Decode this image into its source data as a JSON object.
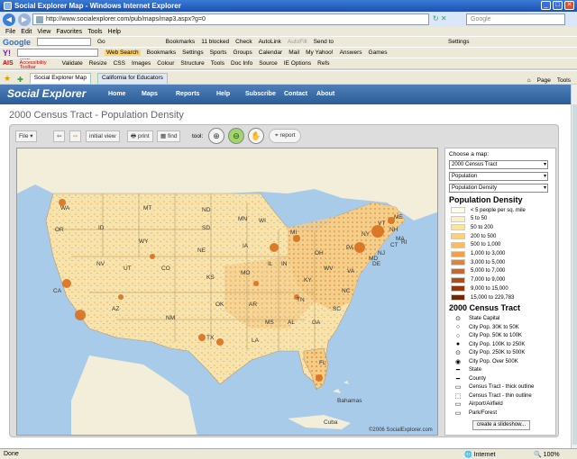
{
  "window": {
    "title": "Social Explorer Map - Windows Internet Explorer"
  },
  "browser": {
    "address": "http://www.socialexplorer.com/pub/maps/map3.aspx?g=0",
    "search_placeholder": "Google",
    "menu": [
      "File",
      "Edit",
      "View",
      "Favorites",
      "Tools",
      "Help"
    ],
    "google_toolbar": [
      "Go",
      "Bookmarks",
      "11 blocked",
      "Check",
      "AutoLink",
      "AutoFill",
      "Send to",
      "Settings"
    ],
    "yahoo_toolbar": [
      "Web Search",
      "Bookmarks",
      "Settings",
      "Sports",
      "Groups",
      "Calendar",
      "Mail",
      "My Yahoo!",
      "Answers",
      "Games"
    ],
    "ais_toolbar": [
      "Web Accessibility Toolbar",
      "Validate",
      "Resize",
      "CSS",
      "Images",
      "Colour",
      "Structure",
      "Tools",
      "Doc Info",
      "Source",
      "IE Options",
      "Refs"
    ],
    "tabs": [
      "Social Explorer Map",
      "California for Educators"
    ],
    "command_bar": [
      "Page",
      "Tools"
    ],
    "status": {
      "left": "Done",
      "zone": "Internet",
      "zoom": "100%"
    }
  },
  "site": {
    "logo": "Social Explorer",
    "nav": [
      "Home",
      "Maps",
      "Reports",
      "Help",
      "Subscribe",
      "Contact",
      "About"
    ],
    "page_title": "2000 Census Tract - Population Density"
  },
  "map_toolbar": {
    "file": "File",
    "initial_view": "initial view",
    "print": "print",
    "find": "find",
    "tool_label": "tool:",
    "report": "report"
  },
  "map": {
    "credit": "©2006 SocialExplorer.com",
    "labels": [
      "WA",
      "MT",
      "ND",
      "MN",
      "OR",
      "ID",
      "SD",
      "WI",
      "ME",
      "WY",
      "MI",
      "NV",
      "NE",
      "IA",
      "NY",
      "VT",
      "NH",
      "UT",
      "CO",
      "IL",
      "IN",
      "OH",
      "PA",
      "MA",
      "CT",
      "RI",
      "CA",
      "KS",
      "MO",
      "WV",
      "VA",
      "NJ",
      "DE",
      "MD",
      "KY",
      "NC",
      "AZ",
      "NM",
      "OK",
      "AR",
      "TN",
      "SC",
      "MS",
      "AL",
      "GA",
      "TX",
      "LA",
      "FL",
      "Bahamas",
      "Cuba"
    ],
    "colors": {
      "water": "#a8cbea",
      "land": "#f7e3ad",
      "dense": "#d9701f"
    }
  },
  "side": {
    "choose": "Choose a map:",
    "select1": "2000 Census Tract",
    "select2": "Population",
    "select3": "Population Density",
    "legend_title": "Population Density",
    "legend": [
      {
        "label": "< 5 people per sq. mile",
        "color": "#fffae0"
      },
      {
        "label": "5 to 50",
        "color": "#fdf0c0"
      },
      {
        "label": "50 to 200",
        "color": "#fbe3a0"
      },
      {
        "label": "200 to 500",
        "color": "#f8d080"
      },
      {
        "label": "500 to 1,000",
        "color": "#f5bb66"
      },
      {
        "label": "1,000 to 3,000",
        "color": "#f0a04c"
      },
      {
        "label": "3,000 to 5,000",
        "color": "#e18234"
      },
      {
        "label": "5,000 to 7,000",
        "color": "#cc6622"
      },
      {
        "label": "7,000 to 9,000",
        "color": "#b04e14"
      },
      {
        "label": "9,000 to 15,000",
        "color": "#8e3a0c"
      },
      {
        "label": "15,000 to 229,783",
        "color": "#6a2806"
      }
    ],
    "ct_title": "2000 Census Tract",
    "ct_items": [
      {
        "sym": "⊙",
        "label": "State Capital"
      },
      {
        "sym": "○",
        "label": "City Pop. 30K to 50K"
      },
      {
        "sym": "○",
        "label": "City Pop. 50K to 100K"
      },
      {
        "sym": "●",
        "label": "City Pop. 100K to 250K"
      },
      {
        "sym": "⊙",
        "label": "City Pop. 250K to 500K"
      },
      {
        "sym": "◉",
        "label": "City Pop. Over 500K"
      },
      {
        "sym": "━",
        "label": "State"
      },
      {
        "sym": "━",
        "label": "County"
      },
      {
        "sym": "▭",
        "label": "Census Tract - thick outline"
      },
      {
        "sym": "⬚",
        "label": "Census Tract - thin outline"
      },
      {
        "sym": "▭",
        "label": "Airport/Airfield"
      },
      {
        "sym": "▭",
        "label": "Park/Forest"
      }
    ],
    "slideshow": "create a slideshow..."
  }
}
